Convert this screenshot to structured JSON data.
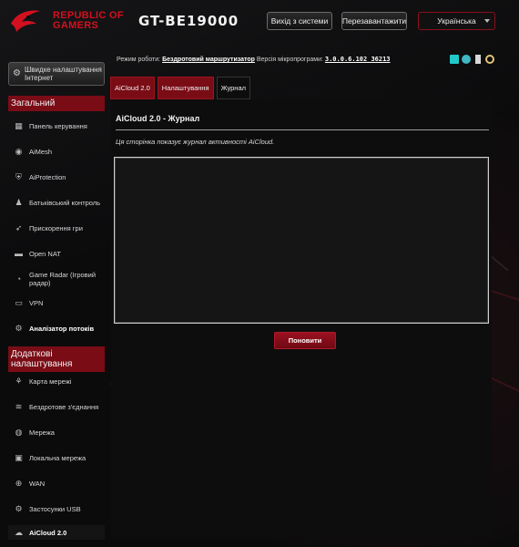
{
  "header": {
    "brand_line1": "REPUBLIC OF",
    "brand_line2": "GAMERS",
    "model": "GT-BE19000",
    "logout_label": "Вихід з системи",
    "reboot_label": "Перезавантажити",
    "language": "Українська"
  },
  "sidebar": {
    "quick_setup": "Швидке налаштування Інтернет",
    "general_title": "Загальний",
    "general_items": [
      {
        "label": "Панель керування",
        "icon": "dashboard-icon"
      },
      {
        "label": "AiMesh",
        "icon": "aimesh-icon"
      },
      {
        "label": "AiProtection",
        "icon": "shield-icon"
      },
      {
        "label": "Батьківський контроль",
        "icon": "parental-control-icon"
      },
      {
        "label": "Прискорення гри",
        "icon": "rocket-icon"
      },
      {
        "label": "Open NAT",
        "icon": "open-nat-icon"
      },
      {
        "label": "Game Radar (Ігровий радар)",
        "icon": "radar-icon"
      },
      {
        "label": "VPN",
        "icon": "vpn-icon"
      },
      {
        "label": "Аналізатор потоків",
        "icon": "traffic-analyzer-icon"
      }
    ],
    "advanced_title": "Додаткові налаштування",
    "advanced_items": [
      {
        "label": "Карта мережі",
        "icon": "network-map-icon"
      },
      {
        "label": "Бездротове з'єднання",
        "icon": "wireless-icon"
      },
      {
        "label": "Мережа",
        "icon": "network-icon"
      },
      {
        "label": "Локальна мережа",
        "icon": "lan-icon"
      },
      {
        "label": "WAN",
        "icon": "wan-icon"
      },
      {
        "label": "Застосунки USB",
        "icon": "usb-icon"
      },
      {
        "label": "AiCloud 2.0",
        "icon": "cloud-icon"
      }
    ]
  },
  "status": {
    "mode_label": "Режим роботи:",
    "mode_value": "Бездротовий маршрутизатор",
    "fw_label": "Версія мікропрограми:",
    "fw_value": "3.0.0.6.102_36213"
  },
  "tabs": [
    {
      "label": "AiCloud 2.0",
      "current": false
    },
    {
      "label": "Налаштування",
      "current": false
    },
    {
      "label": "Журнал",
      "current": true
    }
  ],
  "panel": {
    "title": "AiCloud 2.0 - Журнал",
    "description": "Ця сторінка показує журнал активності AiCloud.",
    "log_content": "",
    "refresh_label": "Поновити"
  },
  "colors": {
    "accent": "#7a0c16",
    "brand_red": "#d3101f",
    "background": "#0b0b0c"
  }
}
